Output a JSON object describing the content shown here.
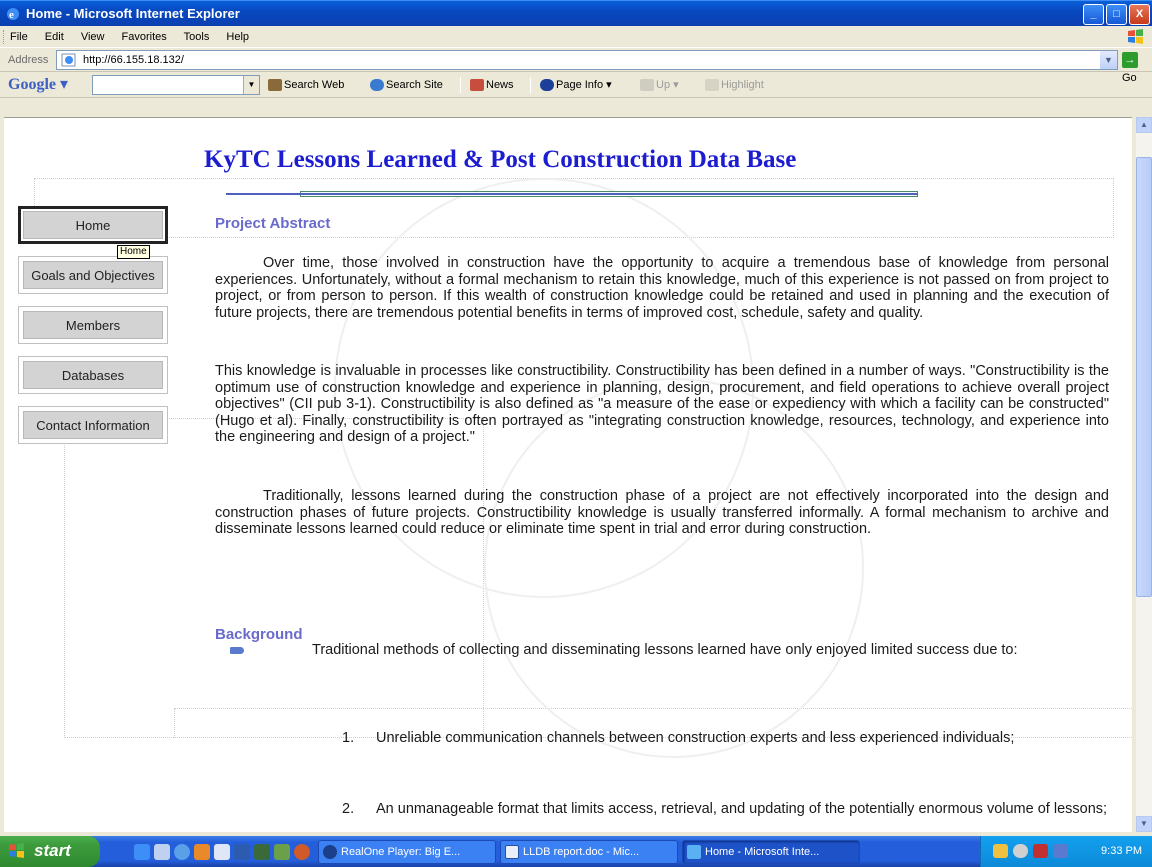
{
  "window": {
    "title": "Home - Microsoft Internet Explorer",
    "min": "_",
    "max": "□",
    "close": "X"
  },
  "menu": [
    "File",
    "Edit",
    "View",
    "Favorites",
    "Tools",
    "Help"
  ],
  "address": {
    "label": "Address",
    "url": "http://66.155.18.132/",
    "go": "Go"
  },
  "google_bar": {
    "logo": "Google",
    "search_web": "Search Web",
    "search_site": "Search Site",
    "news": "News",
    "page_info": "Page Info",
    "up": "Up",
    "highlight": "Highlight"
  },
  "page": {
    "title": "KyTC Lessons Learned & Post Construction Data Base",
    "nav": [
      {
        "label": "Home",
        "active": true
      },
      {
        "label": "Goals and Objectives"
      },
      {
        "label": "Members"
      },
      {
        "label": "Databases"
      },
      {
        "label": "Contact Information"
      }
    ],
    "tooltip": "Home",
    "abstract_heading": "Project Abstract",
    "abstract_paras": [
      "Over time, those involved in construction have the opportunity to acquire a tremendous base of knowledge from personal experiences. Unfortunately, without a formal mechanism to retain this knowledge, much of this experience is not passed on from project to project, or from person to person. If this wealth of construction knowledge could be retained and used in planning and the execution of future projects, there are tremendous potential benefits in terms of improved cost, schedule, safety and quality.",
      "This knowledge is invaluable in processes like constructibility. Constructibility has been defined in a number of ways. \"Constructibility is the optimum use of construction knowledge and experience in planning, design, procurement, and field operations to achieve overall project objectives\" (CII pub 3-1). Constructibility is also defined as \"a measure of the ease or expediency with which a facility can be constructed\" (Hugo et al). Finally, constructibility is often portrayed as \"integrating construction knowledge, resources, technology, and experience into the engineering and design of a project.\"",
      "Traditionally, lessons learned during the construction phase of a project are not effectively incorporated into the design and construction phases of future projects. Constructibility knowledge is usually transferred informally. A formal mechanism to archive and disseminate lessons learned could reduce or eliminate time spent in trial and error during construction."
    ],
    "background_heading": "Background",
    "bullet": "Traditional methods of collecting and disseminating lessons learned have only enjoyed limited success due to:",
    "list": [
      {
        "num": "1.",
        "text": "Unreliable communication channels between construction experts and less experienced individuals;"
      },
      {
        "num": "2.",
        "text": "An unmanageable format that limits access, retrieval, and updating of the potentially enormous volume of lessons;"
      }
    ]
  },
  "taskbar": {
    "start": "start",
    "tasks": [
      {
        "label": "RealOne Player: Big E..."
      },
      {
        "label": "LLDB report.doc - Mic..."
      },
      {
        "label": "Home - Microsoft Inte..."
      }
    ],
    "clock": "9:33 PM"
  }
}
